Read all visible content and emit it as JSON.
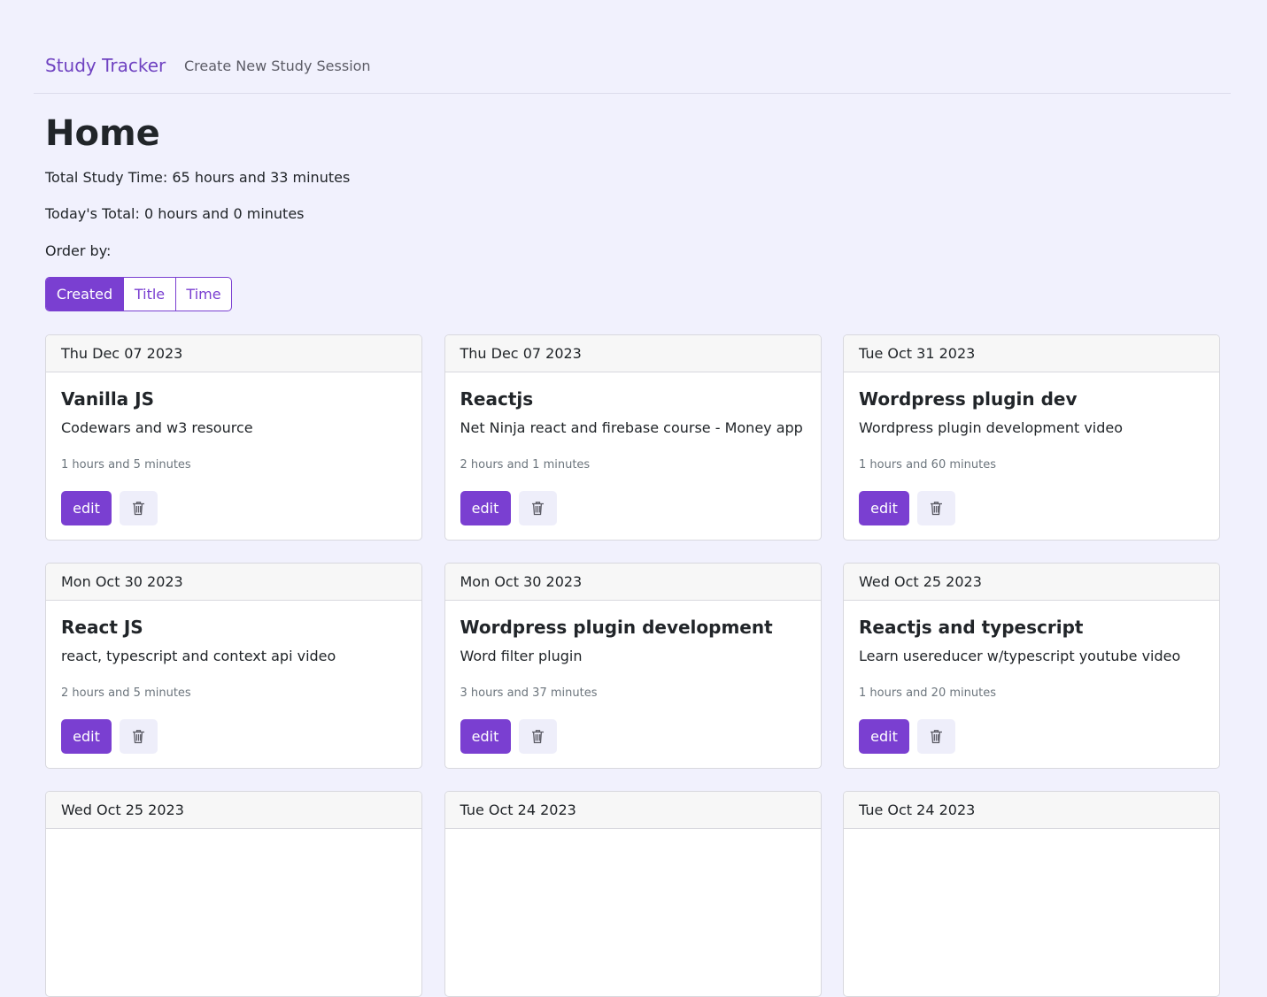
{
  "nav": {
    "brand": "Study Tracker",
    "create_link": "Create New Study Session"
  },
  "page": {
    "title": "Home",
    "total_study_time": "Total Study Time: 65 hours and 33 minutes",
    "today_total": "Today's Total: 0 hours and 0 minutes",
    "order_by_label": "Order by:"
  },
  "order_options": [
    {
      "label": "Created",
      "active": true
    },
    {
      "label": "Title",
      "active": false
    },
    {
      "label": "Time",
      "active": false
    }
  ],
  "colors": {
    "accent": "#7a3fd1",
    "background": "#f1f1fd"
  },
  "card_actions": {
    "edit_label": "edit",
    "delete_icon": "trash-icon"
  },
  "sessions": [
    {
      "date": "Thu Dec 07 2023",
      "title": "Vanilla JS",
      "description": "Codewars and w3 resource",
      "duration": "1 hours and 5 minutes"
    },
    {
      "date": "Thu Dec 07 2023",
      "title": "Reactjs",
      "description": "Net Ninja react and firebase course - Money app",
      "duration": "2 hours and 1 minutes"
    },
    {
      "date": "Tue Oct 31 2023",
      "title": "Wordpress plugin dev",
      "description": "Wordpress plugin development video",
      "duration": "1 hours and 60 minutes"
    },
    {
      "date": "Mon Oct 30 2023",
      "title": "React JS",
      "description": "react, typescript and context api video",
      "duration": "2 hours and 5 minutes"
    },
    {
      "date": "Mon Oct 30 2023",
      "title": "Wordpress plugin development",
      "description": "Word filter plugin",
      "duration": "3 hours and 37 minutes"
    },
    {
      "date": "Wed Oct 25 2023",
      "title": "Reactjs and typescript",
      "description": "Learn usereducer w/typescript youtube video",
      "duration": "1 hours and 20 minutes"
    },
    {
      "date": "Wed Oct 25 2023"
    },
    {
      "date": "Tue Oct 24 2023"
    },
    {
      "date": "Tue Oct 24 2023"
    }
  ]
}
